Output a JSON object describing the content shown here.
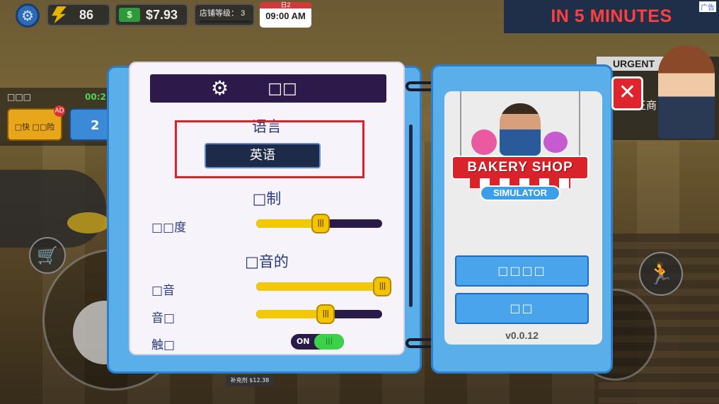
{
  "hud": {
    "energy": "86",
    "money": "$7.93",
    "store_level_label": "店铺等级：",
    "store_level_value": "3",
    "clock_day": "日2",
    "clock_time": "09:00 AM"
  },
  "ad_banner": {
    "text": "IN 5 MINUTES",
    "tag": "广告"
  },
  "urgent": {
    "heading": "URGENT",
    "text": "王商"
  },
  "left_panel": {
    "stats_label": "□□□",
    "stats_value": "00:2",
    "tv_button_label": "□快\n□□险",
    "ad_badge": "AD",
    "blue_button_value": "2"
  },
  "price_tag": "补充剂 $12.38",
  "settings": {
    "header_title": "□□",
    "language_title": "语言",
    "language_value": "英语",
    "controls_title": "□制",
    "sensitivity_label": "□□度",
    "sensitivity_level": 0.51,
    "sound_title": "□音的",
    "music_label": "□音",
    "music_level": 1.0,
    "sfx_label": "音□",
    "sfx_level": 0.55,
    "vibration_label": "触□",
    "vibration_state": "ON",
    "slider_thumb_glyph": "|||"
  },
  "logo": {
    "title": "BAKERY SHOP",
    "subtitle": "SIMULATOR"
  },
  "right_panel": {
    "button1_label": "□□□□",
    "button2_label": "□□",
    "version": "v0.0.12"
  },
  "colors": {
    "panel_blue": "#5aaeea",
    "header_purple": "#2e1a4a",
    "slider_yellow": "#f2c80a",
    "toggle_green": "#3bd24a",
    "close_red": "#e0242e",
    "highlight_red": "#e01f2a"
  },
  "icons": {
    "hud_settings": "gear-icon",
    "energy": "lightning-icon",
    "money": "cash-icon",
    "cart": "cart-icon",
    "run": "running-person-icon",
    "close": "close-icon"
  }
}
